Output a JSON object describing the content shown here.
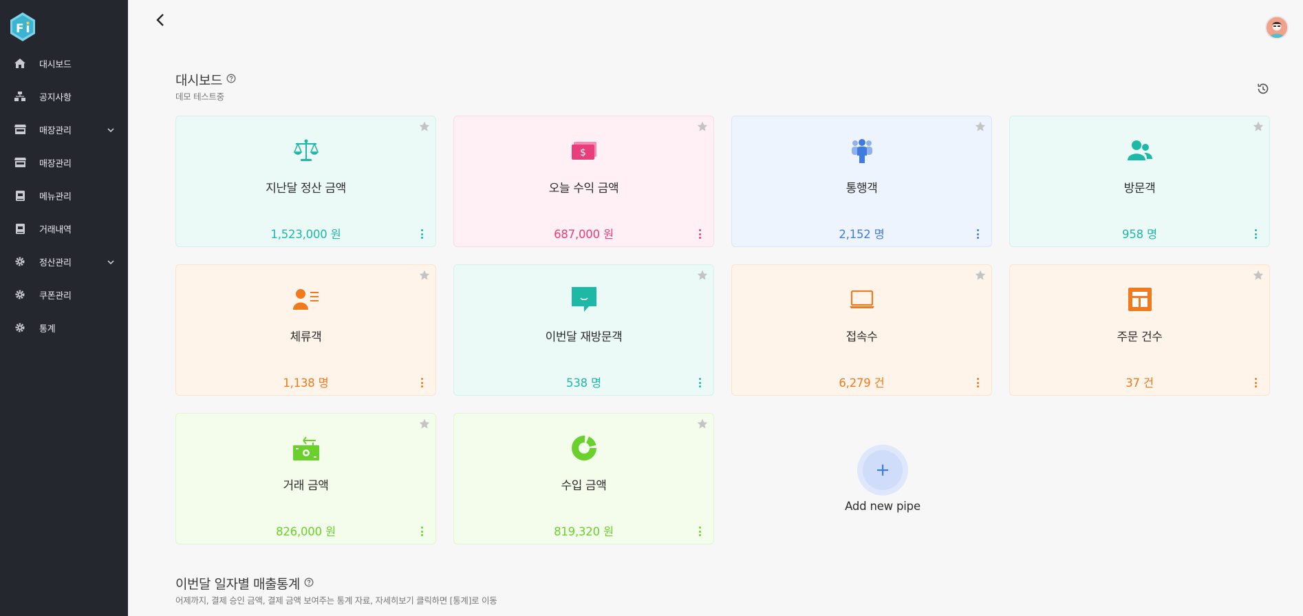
{
  "sidebar": {
    "items": [
      {
        "label": "대시보드",
        "icon": "home-icon"
      },
      {
        "label": "공지사항",
        "icon": "sitemap-icon"
      },
      {
        "label": "매장관리",
        "icon": "store-icon",
        "expandable": true
      },
      {
        "label": "매장관리",
        "icon": "store-icon"
      },
      {
        "label": "메뉴관리",
        "icon": "book-icon"
      },
      {
        "label": "거래내역",
        "icon": "book-icon"
      },
      {
        "label": "정산관리",
        "icon": "gear-icon",
        "expandable": true
      },
      {
        "label": "쿠폰관리",
        "icon": "gear-icon"
      },
      {
        "label": "통계",
        "icon": "gear-icon"
      }
    ]
  },
  "dashboard": {
    "title": "대시보드",
    "subtitle": "데모 테스트중"
  },
  "cards": [
    {
      "title": "지난달 정산 금액",
      "value": "1,523,000 원",
      "icon": "scale-icon",
      "theme": "teal"
    },
    {
      "title": "오늘 수익 금액",
      "value": "687,000 원",
      "icon": "money-icon",
      "theme": "pink"
    },
    {
      "title": "통행객",
      "value": "2,152 명",
      "icon": "people-group-icon",
      "theme": "blue"
    },
    {
      "title": "방문객",
      "value": "958 명",
      "icon": "users-icon",
      "theme": "teal"
    },
    {
      "title": "체류객",
      "value": "1,138 명",
      "icon": "user-list-icon",
      "theme": "orange"
    },
    {
      "title": "이번달 재방문객",
      "value": "538 명",
      "icon": "chat-icon",
      "theme": "teal"
    },
    {
      "title": "접속수",
      "value": "6,279 건",
      "icon": "laptop-icon",
      "theme": "orange"
    },
    {
      "title": "주문 건수",
      "value": "37 건",
      "icon": "layout-icon",
      "theme": "orange"
    },
    {
      "title": "거래 금액",
      "value": "826,000 원",
      "icon": "cash-exchange-icon",
      "theme": "green"
    },
    {
      "title": "수입 금액",
      "value": "819,320 원",
      "icon": "donut-chart-icon",
      "theme": "green"
    }
  ],
  "add_pipe": {
    "label": "Add new pipe"
  },
  "sales_section": {
    "title": "이번달 일자별 매출통계",
    "subtitle": "어제까지, 결제 승인 금액, 결제 금액 보여주는 통계 자료, 자세히보기 클릭하면 [통계]로 이동"
  },
  "colors": {
    "teal": "#1eb8a6",
    "pink": "#e83e7c",
    "blue": "#3f7be0",
    "orange": "#f07a1e",
    "green": "#6ad12c",
    "sidebar_bg": "#24272e"
  }
}
